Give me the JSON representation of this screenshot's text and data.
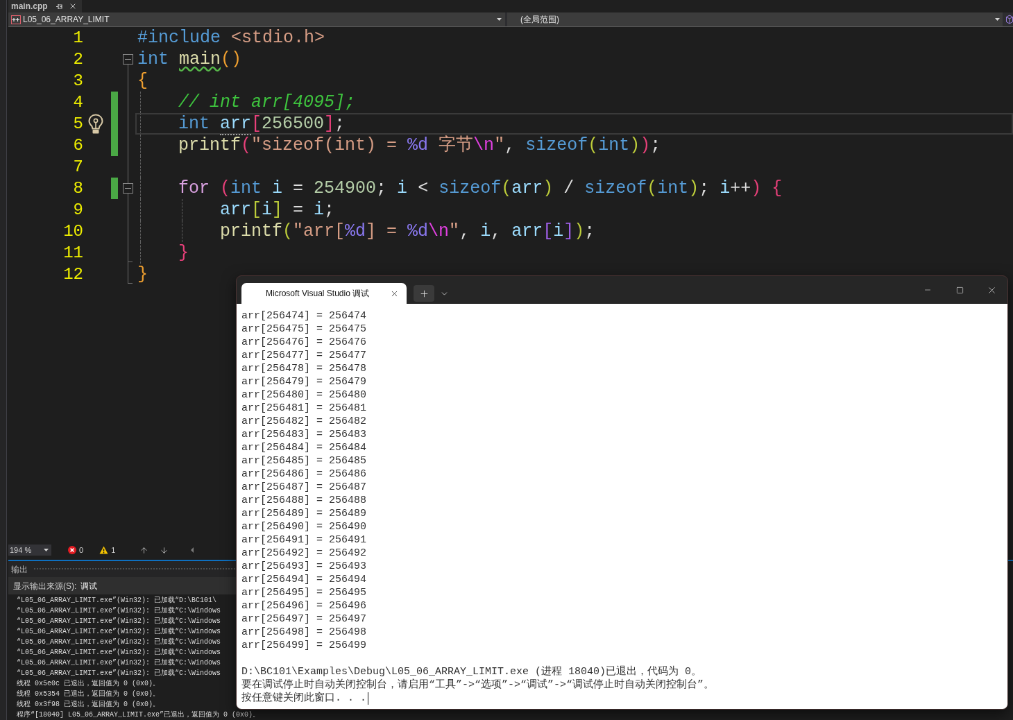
{
  "editor_tab": {
    "title": "main.cpp"
  },
  "navigation_bar": {
    "project": "L05_06_ARRAY_LIMIT",
    "scope": "(全局范围)"
  },
  "code_lines": [
    {
      "number": "1",
      "changed": false,
      "current": false,
      "hint": false,
      "tokens": [
        {
          "kind": "keyword",
          "text": "#include ",
          "warning": false,
          "suggestion": false
        },
        {
          "kind": "string",
          "text": "<stdio.h>",
          "warning": false,
          "suggestion": false
        }
      ]
    },
    {
      "number": "2",
      "changed": false,
      "current": false,
      "hint": false,
      "fold": {
        "expanded": true
      },
      "tokens": [
        {
          "kind": "keyword",
          "text": "int ",
          "warning": false,
          "suggestion": false
        },
        {
          "kind": "function",
          "text": "main",
          "warning": true,
          "suggestion": false
        },
        {
          "kind": "bracket1",
          "text": "()",
          "warning": false,
          "suggestion": false
        }
      ]
    },
    {
      "number": "3",
      "changed": false,
      "current": false,
      "hint": false,
      "tokens": [
        {
          "kind": "bracket1",
          "text": "{",
          "warning": false,
          "suggestion": false
        }
      ]
    },
    {
      "number": "4",
      "changed": true,
      "current": false,
      "hint": false,
      "tokens": [
        {
          "kind": "comment",
          "text": "    // int arr[4095];",
          "warning": false,
          "suggestion": false
        }
      ]
    },
    {
      "number": "5",
      "changed": true,
      "current": true,
      "hint": true,
      "tokens": [
        {
          "kind": "keyword",
          "text": "    int ",
          "warning": false,
          "suggestion": false
        },
        {
          "kind": "variable",
          "text": "arr",
          "warning": false,
          "suggestion": true
        },
        {
          "kind": "bracket2",
          "text": "[",
          "warning": false,
          "suggestion": false
        },
        {
          "kind": "number",
          "text": "256500",
          "warning": false,
          "suggestion": false
        },
        {
          "kind": "bracket2",
          "text": "]",
          "warning": false,
          "suggestion": false
        },
        {
          "kind": "plain",
          "text": ";",
          "warning": false,
          "suggestion": false
        }
      ]
    },
    {
      "number": "6",
      "changed": true,
      "current": false,
      "hint": false,
      "tokens": [
        {
          "kind": "function",
          "text": "    printf",
          "warning": false,
          "suggestion": false
        },
        {
          "kind": "bracket2",
          "text": "(",
          "warning": false,
          "suggestion": false
        },
        {
          "kind": "string",
          "text": "\"sizeof(int) = ",
          "warning": false,
          "suggestion": false
        },
        {
          "kind": "format",
          "text": "%d",
          "warning": false,
          "suggestion": false
        },
        {
          "kind": "string",
          "text": " 字节",
          "warning": false,
          "suggestion": false
        },
        {
          "kind": "escape",
          "text": "\\n",
          "warning": false,
          "suggestion": false
        },
        {
          "kind": "string",
          "text": "\"",
          "warning": false,
          "suggestion": false
        },
        {
          "kind": "plain",
          "text": ", ",
          "warning": false,
          "suggestion": false
        },
        {
          "kind": "keyword",
          "text": "sizeof",
          "warning": false,
          "suggestion": false
        },
        {
          "kind": "bracket3",
          "text": "(",
          "warning": false,
          "suggestion": false
        },
        {
          "kind": "keyword",
          "text": "int",
          "warning": false,
          "suggestion": false
        },
        {
          "kind": "bracket3",
          "text": ")",
          "warning": false,
          "suggestion": false
        },
        {
          "kind": "bracket2",
          "text": ")",
          "warning": false,
          "suggestion": false
        },
        {
          "kind": "plain",
          "text": ";",
          "warning": false,
          "suggestion": false
        }
      ]
    },
    {
      "number": "7",
      "changed": false,
      "current": false,
      "hint": false
    },
    {
      "number": "8",
      "changed": true,
      "current": false,
      "hint": false,
      "fold": {
        "expanded": true
      },
      "tokens": [
        {
          "kind": "control",
          "text": "    for ",
          "warning": false,
          "suggestion": false
        },
        {
          "kind": "bracket2",
          "text": "(",
          "warning": false,
          "suggestion": false
        },
        {
          "kind": "keyword",
          "text": "int ",
          "warning": false,
          "suggestion": false
        },
        {
          "kind": "variable",
          "text": "i",
          "warning": false,
          "suggestion": false
        },
        {
          "kind": "plain",
          "text": " = ",
          "warning": false,
          "suggestion": false
        },
        {
          "kind": "number",
          "text": "254900",
          "warning": false,
          "suggestion": false
        },
        {
          "kind": "plain",
          "text": "; ",
          "warning": false,
          "suggestion": false
        },
        {
          "kind": "variable",
          "text": "i",
          "warning": false,
          "suggestion": false
        },
        {
          "kind": "plain",
          "text": " < ",
          "warning": false,
          "suggestion": false
        },
        {
          "kind": "keyword",
          "text": "sizeof",
          "warning": false,
          "suggestion": false
        },
        {
          "kind": "bracket3",
          "text": "(",
          "warning": false,
          "suggestion": false
        },
        {
          "kind": "variable",
          "text": "arr",
          "warning": false,
          "suggestion": false
        },
        {
          "kind": "bracket3",
          "text": ")",
          "warning": false,
          "suggestion": false
        },
        {
          "kind": "plain",
          "text": " / ",
          "warning": false,
          "suggestion": false
        },
        {
          "kind": "keyword",
          "text": "sizeof",
          "warning": false,
          "suggestion": false
        },
        {
          "kind": "bracket3",
          "text": "(",
          "warning": false,
          "suggestion": false
        },
        {
          "kind": "keyword",
          "text": "int",
          "warning": false,
          "suggestion": false
        },
        {
          "kind": "bracket3",
          "text": ")",
          "warning": false,
          "suggestion": false
        },
        {
          "kind": "plain",
          "text": "; ",
          "warning": false,
          "suggestion": false
        },
        {
          "kind": "variable",
          "text": "i",
          "warning": false,
          "suggestion": false
        },
        {
          "kind": "plain",
          "text": "++",
          "warning": false,
          "suggestion": false
        },
        {
          "kind": "bracket2",
          "text": ") {",
          "warning": false,
          "suggestion": false
        }
      ]
    },
    {
      "number": "9",
      "changed": false,
      "current": false,
      "hint": false,
      "tokens": [
        {
          "kind": "variable",
          "text": "        arr",
          "warning": false,
          "suggestion": false
        },
        {
          "kind": "bracket3",
          "text": "[",
          "warning": false,
          "suggestion": false
        },
        {
          "kind": "variable",
          "text": "i",
          "warning": false,
          "suggestion": false
        },
        {
          "kind": "bracket3",
          "text": "]",
          "warning": false,
          "suggestion": false
        },
        {
          "kind": "plain",
          "text": " = ",
          "warning": false,
          "suggestion": false
        },
        {
          "kind": "variable",
          "text": "i",
          "warning": false,
          "suggestion": false
        },
        {
          "kind": "plain",
          "text": ";",
          "warning": false,
          "suggestion": false
        }
      ]
    },
    {
      "number": "10",
      "changed": false,
      "current": false,
      "hint": false,
      "tokens": [
        {
          "kind": "function",
          "text": "        printf",
          "warning": false,
          "suggestion": false
        },
        {
          "kind": "bracket3",
          "text": "(",
          "warning": false,
          "suggestion": false
        },
        {
          "kind": "string",
          "text": "\"arr[",
          "warning": false,
          "suggestion": false
        },
        {
          "kind": "format",
          "text": "%d",
          "warning": false,
          "suggestion": false
        },
        {
          "kind": "string",
          "text": "] = ",
          "warning": false,
          "suggestion": false
        },
        {
          "kind": "format",
          "text": "%d",
          "warning": false,
          "suggestion": false
        },
        {
          "kind": "escape",
          "text": "\\n",
          "warning": false,
          "suggestion": false
        },
        {
          "kind": "string",
          "text": "\"",
          "warning": false,
          "suggestion": false
        },
        {
          "kind": "plain",
          "text": ", ",
          "warning": false,
          "suggestion": false
        },
        {
          "kind": "variable",
          "text": "i",
          "warning": false,
          "suggestion": false
        },
        {
          "kind": "plain",
          "text": ", ",
          "warning": false,
          "suggestion": false
        },
        {
          "kind": "variable",
          "text": "arr",
          "warning": false,
          "suggestion": false
        },
        {
          "kind": "bracket4",
          "text": "[",
          "warning": false,
          "suggestion": false
        },
        {
          "kind": "variable",
          "text": "i",
          "warning": false,
          "suggestion": false
        },
        {
          "kind": "bracket4",
          "text": "]",
          "warning": false,
          "suggestion": false
        },
        {
          "kind": "bracket3",
          "text": ")",
          "warning": false,
          "suggestion": false
        },
        {
          "kind": "plain",
          "text": ";",
          "warning": false,
          "suggestion": false
        }
      ]
    },
    {
      "number": "11",
      "changed": false,
      "current": false,
      "hint": false,
      "tokens": [
        {
          "kind": "bracket2",
          "text": "    }",
          "warning": false,
          "suggestion": false
        }
      ]
    },
    {
      "number": "12",
      "changed": false,
      "current": false,
      "hint": false,
      "tokens": [
        {
          "kind": "bracket1",
          "text": "}",
          "warning": false,
          "suggestion": false
        }
      ]
    }
  ],
  "status_bar": {
    "zoom": "194 %",
    "errors": "0",
    "warnings": "1"
  },
  "output_panel": {
    "title": "输出",
    "source_label": "显示输出来源(S):",
    "source": "调试",
    "lines": [
      "“L05_06_ARRAY_LIMIT.exe”(Win32): 已加载“D:\\BC101\\",
      "“L05_06_ARRAY_LIMIT.exe”(Win32): 已加载“C:\\Windows",
      "“L05_06_ARRAY_LIMIT.exe”(Win32): 已加载“C:\\Windows",
      "“L05_06_ARRAY_LIMIT.exe”(Win32): 已加载“C:\\Windows",
      "“L05_06_ARRAY_LIMIT.exe”(Win32): 已加载“C:\\Windows",
      "“L05_06_ARRAY_LIMIT.exe”(Win32): 已加载“C:\\Windows",
      "“L05_06_ARRAY_LIMIT.exe”(Win32): 已加载“C:\\Windows",
      "“L05_06_ARRAY_LIMIT.exe”(Win32): 已加载“C:\\Windows",
      "线程 0x5e0c 已退出，返回值为 0 (0x0)。",
      "线程 0x5354 已退出，返回值为 0 (0x0)。",
      "线程 0x3f98 已退出，返回值为 0 (0x0)。",
      "程序“[18040] L05_06_ARRAY_LIMIT.exe”已退出，返回值为 0 (0x0)。"
    ]
  },
  "console_window": {
    "tab_title": "Microsoft Visual Studio 调试",
    "lines": [
      "arr[256474] = 256474",
      "arr[256475] = 256475",
      "arr[256476] = 256476",
      "arr[256477] = 256477",
      "arr[256478] = 256478",
      "arr[256479] = 256479",
      "arr[256480] = 256480",
      "arr[256481] = 256481",
      "arr[256482] = 256482",
      "arr[256483] = 256483",
      "arr[256484] = 256484",
      "arr[256485] = 256485",
      "arr[256486] = 256486",
      "arr[256487] = 256487",
      "arr[256488] = 256488",
      "arr[256489] = 256489",
      "arr[256490] = 256490",
      "arr[256491] = 256491",
      "arr[256492] = 256492",
      "arr[256493] = 256493",
      "arr[256494] = 256494",
      "arr[256495] = 256495",
      "arr[256496] = 256496",
      "arr[256497] = 256497",
      "arr[256498] = 256498",
      "arr[256499] = 256499"
    ],
    "messages": [
      "D:\\BC101\\Examples\\Debug\\L05_06_ARRAY_LIMIT.exe (进程 18040)已退出，代码为 0。",
      "要在调试停止时自动关闭控制台，请启用“工具”->“选项”->“调试”->“调试停止时自动关闭控制台”。",
      "按任意键关闭此窗口. . ."
    ]
  }
}
